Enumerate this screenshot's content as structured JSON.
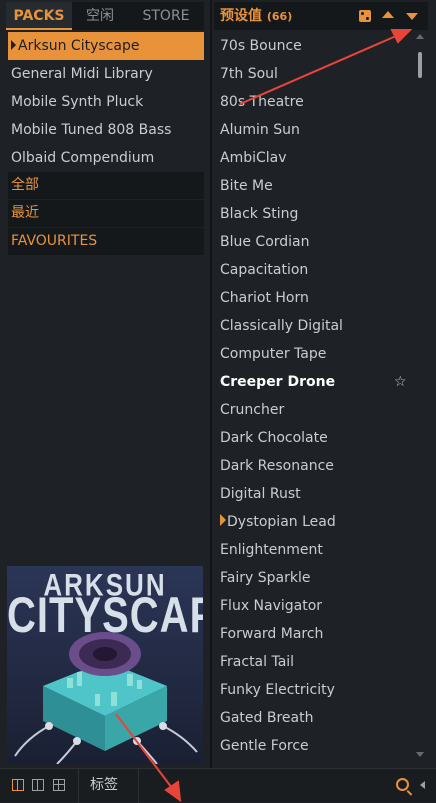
{
  "tabs": {
    "packs": "PACKS",
    "idle": "空闲",
    "store": "STORE"
  },
  "packs": [
    "Arksun Cityscape",
    "General Midi Library",
    "Mobile Synth Pluck",
    "Mobile Tuned 808 Bass",
    "Olbaid Compendium"
  ],
  "selected_pack": "Arksun Cityscape",
  "filters": {
    "all": "全部",
    "recent": "最近",
    "favourites": "FAVOURITES"
  },
  "artwork": {
    "line1": "ARKSUN",
    "line2": "CITYSCAPE"
  },
  "presets_header": {
    "title": "预设值",
    "count": "(66)"
  },
  "presets": [
    "70s Bounce",
    "7th Soul",
    "80s Theatre",
    "Alumin Sun",
    "AmbiClav",
    "Bite Me",
    "Black Sting",
    "Blue Cordian",
    "Capacitation",
    "Chariot Horn",
    "Classically Digital",
    "Computer Tape",
    "Creeper Drone",
    "Cruncher",
    "Dark Chocolate",
    "Dark Resonance",
    "Digital Rust",
    "Dystopian Lead",
    "Enlightenment",
    "Fairy Sparkle",
    "Flux Navigator",
    "Forward March",
    "Fractal Tail",
    "Funky Electricity",
    "Gated Breath",
    "Gentle Force"
  ],
  "highlighted_preset": "Creeper Drone",
  "playing_preset": "Dystopian Lead",
  "star_glyph": "☆",
  "bottom": {
    "tags": "标签"
  },
  "colors": {
    "accent": "#e8933a",
    "background": "#1e2226",
    "annotation_arrow": "#e8443a"
  }
}
